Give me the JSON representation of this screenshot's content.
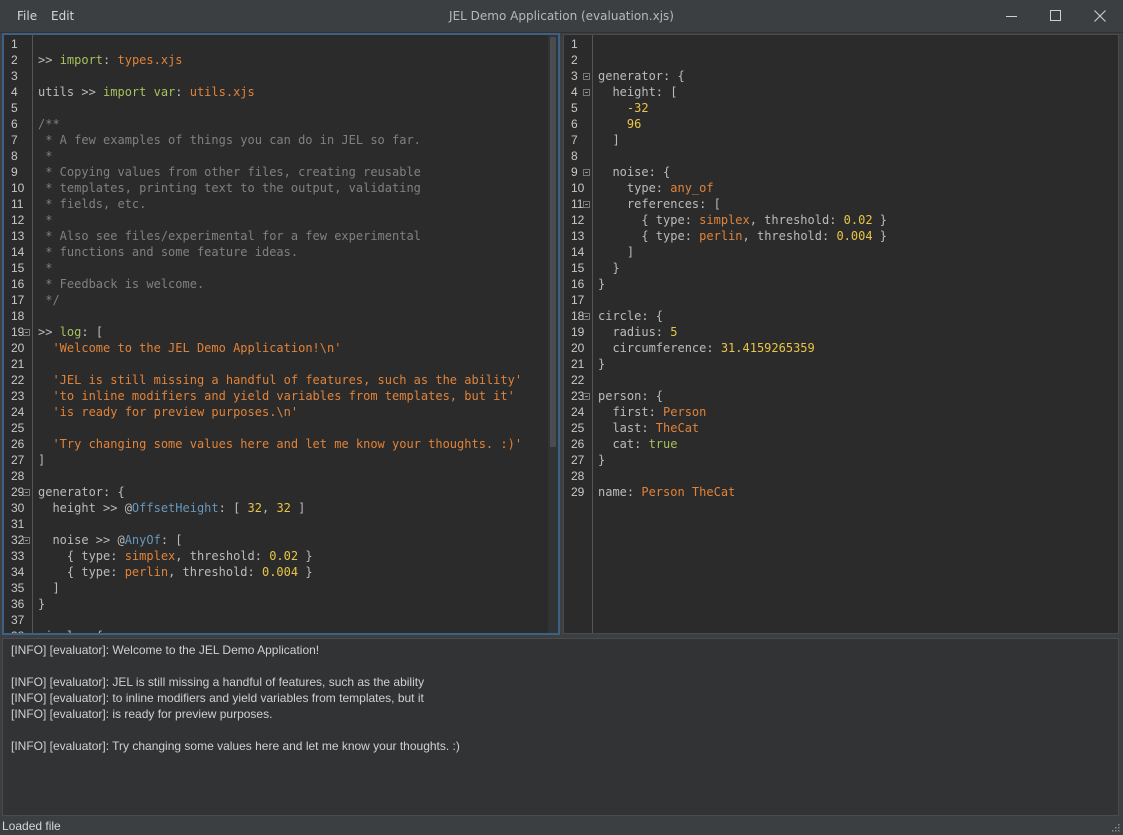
{
  "window": {
    "title": "JEL Demo Application (evaluation.xjs)",
    "menu": [
      "File",
      "Edit"
    ]
  },
  "left_editor": {
    "lines": [
      [],
      [
        [
          ">> ",
          "key"
        ],
        [
          "import",
          "kw"
        ],
        [
          ": ",
          "key"
        ],
        [
          "types.xjs",
          "str"
        ]
      ],
      [],
      [
        [
          "utils >> ",
          "key"
        ],
        [
          "import var",
          "kw"
        ],
        [
          ": ",
          "key"
        ],
        [
          "utils.xjs",
          "str"
        ]
      ],
      [],
      [
        [
          "/**",
          "comment"
        ]
      ],
      [
        [
          " * A few examples of things you can do in JEL so far.",
          "comment"
        ]
      ],
      [
        [
          " *",
          "comment"
        ]
      ],
      [
        [
          " * Copying values from other files, creating reusable",
          "comment"
        ]
      ],
      [
        [
          " * templates, printing text to the output, validating",
          "comment"
        ]
      ],
      [
        [
          " * fields, etc.",
          "comment"
        ]
      ],
      [
        [
          " *",
          "comment"
        ]
      ],
      [
        [
          " * Also see files/experimental for a few experimental",
          "comment"
        ]
      ],
      [
        [
          " * functions and some feature ideas.",
          "comment"
        ]
      ],
      [
        [
          " *",
          "comment"
        ]
      ],
      [
        [
          " * Feedback is welcome.",
          "comment"
        ]
      ],
      [
        [
          " */",
          "comment"
        ]
      ],
      [],
      [
        [
          ">> ",
          "key"
        ],
        [
          "log",
          "kw"
        ],
        [
          ": [",
          "key"
        ]
      ],
      [
        [
          "  ",
          "key"
        ],
        [
          "'Welcome to the JEL Demo Application!\\n'",
          "str"
        ]
      ],
      [],
      [
        [
          "  ",
          "key"
        ],
        [
          "'JEL is still missing a handful of features, such as the ability'",
          "str"
        ]
      ],
      [
        [
          "  ",
          "key"
        ],
        [
          "'to inline modifiers and yield variables from templates, but it'",
          "str"
        ]
      ],
      [
        [
          "  ",
          "key"
        ],
        [
          "'is ready for preview purposes.\\n'",
          "str"
        ]
      ],
      [],
      [
        [
          "  ",
          "key"
        ],
        [
          "'Try changing some values here and let me know your thoughts. :)'",
          "str"
        ]
      ],
      [
        [
          "]",
          "key"
        ]
      ],
      [],
      [
        [
          "generator: {",
          "key"
        ]
      ],
      [
        [
          "  height >> @",
          "key"
        ],
        [
          "OffsetHeight",
          "type"
        ],
        [
          ": [ ",
          "key"
        ],
        [
          "32",
          "num"
        ],
        [
          ", ",
          "key"
        ],
        [
          "32",
          "num"
        ],
        [
          " ]",
          "key"
        ]
      ],
      [],
      [
        [
          "  noise >> @",
          "key"
        ],
        [
          "AnyOf",
          "type"
        ],
        [
          ": [",
          "key"
        ]
      ],
      [
        [
          "    { type: ",
          "key"
        ],
        [
          "simplex",
          "str"
        ],
        [
          ", threshold: ",
          "key"
        ],
        [
          "0.02",
          "num"
        ],
        [
          " }",
          "key"
        ]
      ],
      [
        [
          "    { type: ",
          "key"
        ],
        [
          "perlin",
          "str"
        ],
        [
          ", threshold: ",
          "key"
        ],
        [
          "0.004",
          "num"
        ],
        [
          " }",
          "key"
        ]
      ],
      [
        [
          "  ]",
          "key"
        ]
      ],
      [
        [
          "}",
          "key"
        ]
      ],
      [],
      [
        [
          "circle: {",
          "key"
        ]
      ]
    ],
    "folds": [
      19,
      29,
      32
    ]
  },
  "right_editor": {
    "lines": [
      [],
      [],
      [
        [
          "generator: {",
          "key"
        ]
      ],
      [
        [
          "  height: [",
          "key"
        ]
      ],
      [
        [
          "    ",
          "key"
        ],
        [
          "-32",
          "num"
        ]
      ],
      [
        [
          "    ",
          "key"
        ],
        [
          "96",
          "num"
        ]
      ],
      [
        [
          "  ]",
          "key"
        ]
      ],
      [],
      [
        [
          "  noise: {",
          "key"
        ]
      ],
      [
        [
          "    type: ",
          "key"
        ],
        [
          "any_of",
          "str"
        ]
      ],
      [
        [
          "    references: [",
          "key"
        ]
      ],
      [
        [
          "      { type: ",
          "key"
        ],
        [
          "simplex",
          "str"
        ],
        [
          ", threshold: ",
          "key"
        ],
        [
          "0.02",
          "num"
        ],
        [
          " }",
          "key"
        ]
      ],
      [
        [
          "      { type: ",
          "key"
        ],
        [
          "perlin",
          "str"
        ],
        [
          ", threshold: ",
          "key"
        ],
        [
          "0.004",
          "num"
        ],
        [
          " }",
          "key"
        ]
      ],
      [
        [
          "    ]",
          "key"
        ]
      ],
      [
        [
          "  }",
          "key"
        ]
      ],
      [
        [
          "}",
          "key"
        ]
      ],
      [],
      [
        [
          "circle: {",
          "key"
        ]
      ],
      [
        [
          "  radius: ",
          "key"
        ],
        [
          "5",
          "num"
        ]
      ],
      [
        [
          "  circumference: ",
          "key"
        ],
        [
          "31.4159265359",
          "num"
        ]
      ],
      [
        [
          "}",
          "key"
        ]
      ],
      [],
      [
        [
          "person: {",
          "key"
        ]
      ],
      [
        [
          "  first: ",
          "key"
        ],
        [
          "Person",
          "str"
        ]
      ],
      [
        [
          "  last: ",
          "key"
        ],
        [
          "TheCat",
          "str"
        ]
      ],
      [
        [
          "  cat: ",
          "key"
        ],
        [
          "true",
          "kw"
        ]
      ],
      [
        [
          "}",
          "key"
        ]
      ],
      [],
      [
        [
          "name: ",
          "key"
        ],
        [
          "Person TheCat",
          "str"
        ]
      ]
    ],
    "folds": [
      3,
      4,
      9,
      11,
      18,
      23
    ]
  },
  "console": {
    "lines": [
      "[INFO] [evaluator]: Welcome to the JEL Demo Application!",
      "",
      "[INFO] [evaluator]: JEL is still missing a handful of features, such as the ability",
      "[INFO] [evaluator]: to inline modifiers and yield variables from templates, but it",
      "[INFO] [evaluator]: is ready for preview purposes.",
      "",
      "[INFO] [evaluator]: Try changing some values here and let me know your thoughts. :)"
    ]
  },
  "status": {
    "text": "Loaded file"
  },
  "icons": {
    "minimize": "minimize-icon",
    "maximize": "maximize-icon",
    "close": "close-icon",
    "fold": "fold-collapse-icon",
    "resize": "resize-grip-icon"
  }
}
